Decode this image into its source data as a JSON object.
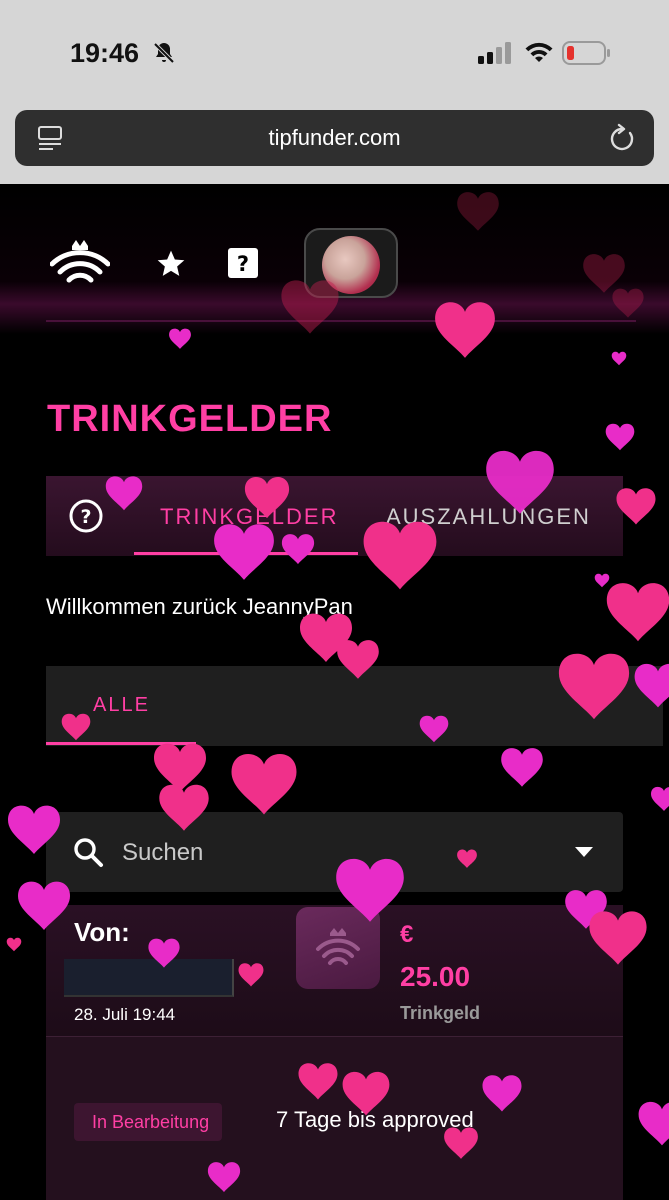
{
  "status_bar": {
    "time": "19:46"
  },
  "browser": {
    "url": "tipfunder.com"
  },
  "page": {
    "title": "TRINKGELDER",
    "welcome": "Willkommen zurück JeannyPan"
  },
  "tabs_main": [
    {
      "label": "TRINKGELDER",
      "active": true
    },
    {
      "label": "AUSZAHLUNGEN",
      "active": false
    }
  ],
  "tabs_filter": [
    {
      "label": "ALLE",
      "active": true
    }
  ],
  "search": {
    "placeholder": "Suchen"
  },
  "tip_card": {
    "from_label": "Von:",
    "date": "28. Juli 19:44",
    "currency": "€",
    "amount": "25.00",
    "type": "Trinkgeld",
    "status": "In Bearbeitung",
    "days_text": "7 Tage bis approved"
  },
  "colors": {
    "accent": "#ff3fa4",
    "heart_pink": "#f0308a",
    "heart_magenta": "#e82cc8",
    "background": "#000000",
    "status_bar": "#d6d6d6"
  },
  "icons": {
    "logo": "crown-wifi-logo-icon",
    "favorites": "star-icon",
    "help": "question-icon",
    "search": "search-icon",
    "dropdown": "caret-down-icon",
    "reload": "reload-icon",
    "reader": "reader-icon"
  }
}
